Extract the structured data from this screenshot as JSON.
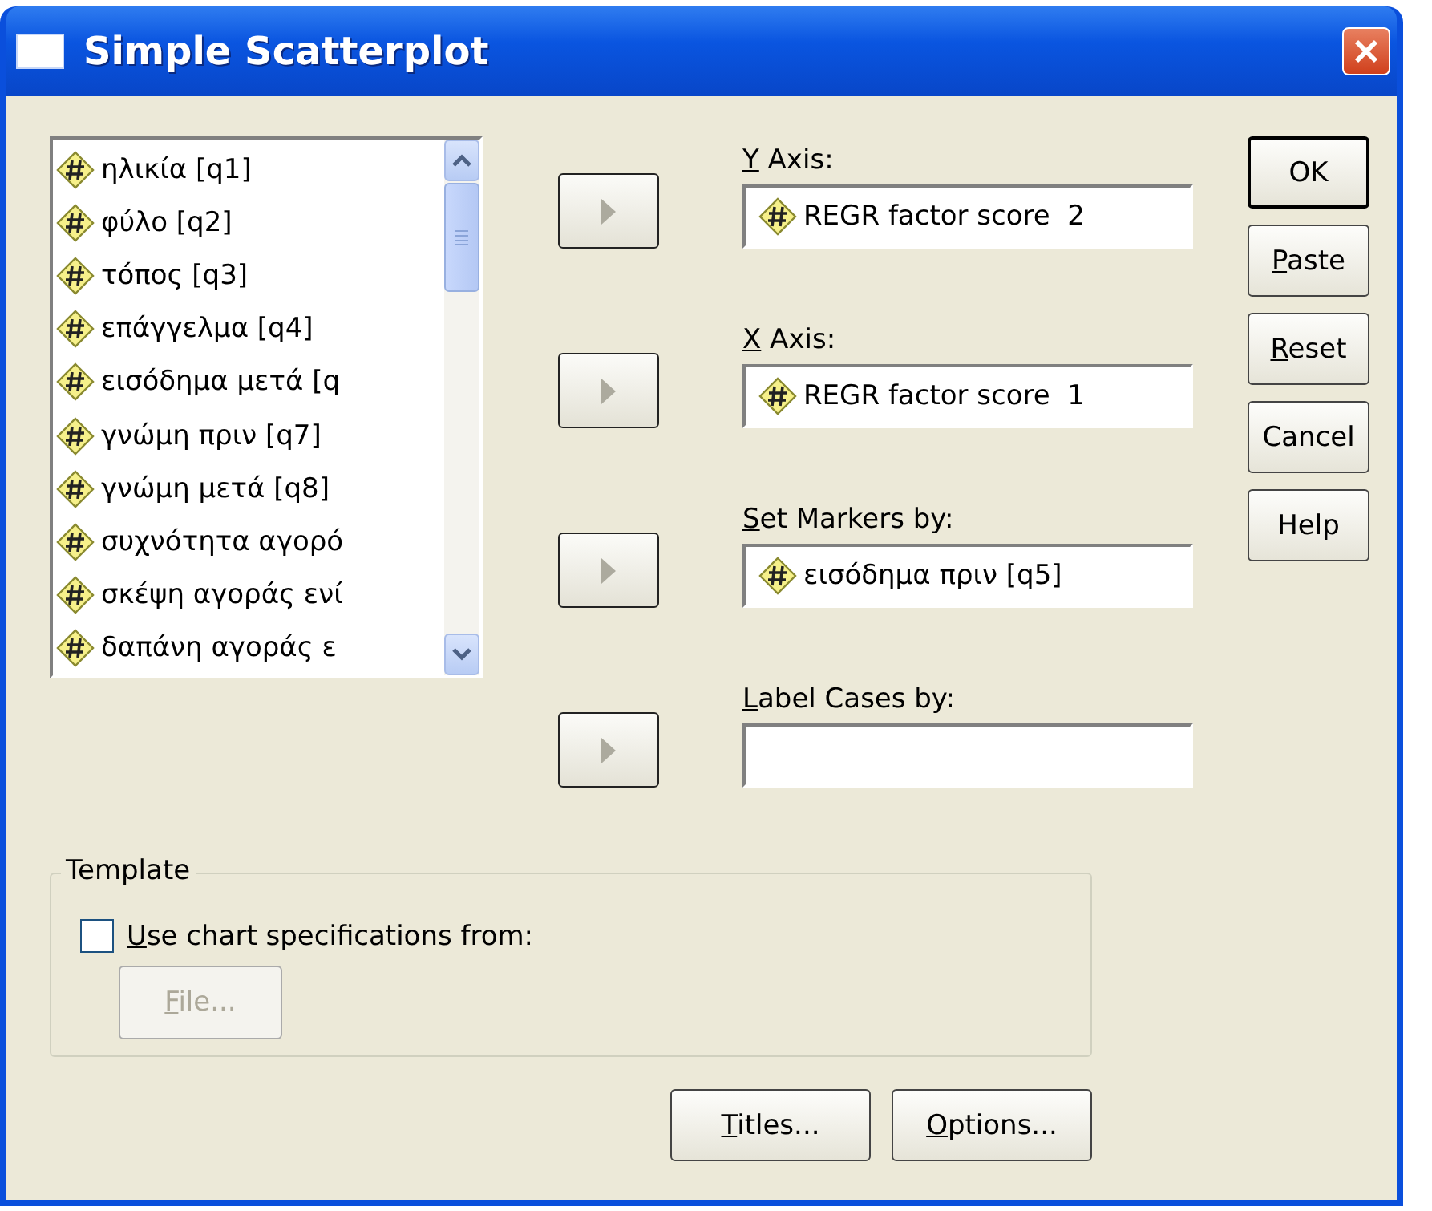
{
  "window": {
    "title": "Simple Scatterplot"
  },
  "variables": [
    {
      "label": "ηλικία [q1]"
    },
    {
      "label": "φύλο [q2]"
    },
    {
      "label": "τόπος [q3]"
    },
    {
      "label": "επάγγελμα [q4]"
    },
    {
      "label": "εισόδημα μετά [q"
    },
    {
      "label": "γνώμη πριν [q7]"
    },
    {
      "label": "γνώμη μετά [q8]"
    },
    {
      "label": "συχνότητα αγορό"
    },
    {
      "label": "σκέψη αγοράς ενί"
    },
    {
      "label": "δαπάνη αγοράς ε"
    }
  ],
  "targets": [
    {
      "label": "Y Axis:",
      "mnemonic": true,
      "value": "REGR factor score  2"
    },
    {
      "label": "X Axis:",
      "mnemonic": true,
      "value": "REGR factor score  1"
    },
    {
      "label": "Set Markers by:",
      "mnemonic": true,
      "value": "εισόδημα πριν [q5]"
    },
    {
      "label": "Label Cases by:",
      "mnemonic": true
    }
  ],
  "buttons": [
    {
      "label": "OK",
      "mnemonic": false,
      "default": true
    },
    {
      "label": "Paste",
      "mnemonic": true,
      "default": false
    },
    {
      "label": "Reset",
      "mnemonic": true,
      "default": false
    },
    {
      "label": "Cancel",
      "mnemonic": false,
      "default": false
    },
    {
      "label": "Help",
      "mnemonic": false,
      "default": false
    }
  ],
  "template": {
    "title": "Template",
    "checkbox": {
      "label": "Use chart specifications from:",
      "mnemonic": true,
      "checked": false
    },
    "file_button": {
      "label": "File...",
      "mnemonic": true,
      "disabled": true
    }
  },
  "bottom_buttons": [
    {
      "label": "Titles...",
      "mnemonic": true
    },
    {
      "label": "Options...",
      "mnemonic": true
    }
  ]
}
